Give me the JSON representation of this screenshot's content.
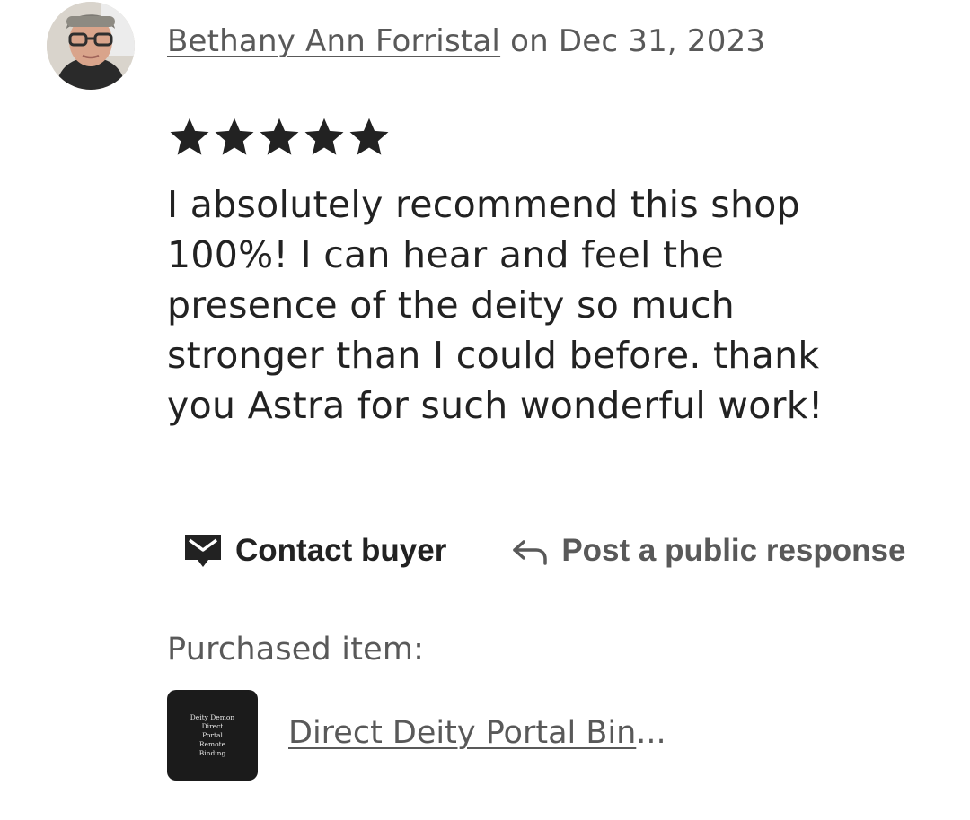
{
  "review": {
    "reviewer_name": "Bethany Ann Forristal",
    "date_text": " on Dec 31, 2023",
    "rating": 5,
    "rating_max": 5,
    "star_color": "#222222",
    "text": "I absolutely recommend this shop 100%! I can hear and feel the presence of the deity so much stronger than I could before. thank you Astra for such wonderful work!"
  },
  "actions": {
    "contact_label": "Contact buyer",
    "contact_icon": "mail-chat-icon",
    "response_label": "Post a public response",
    "response_icon": "reply-arrow-icon"
  },
  "purchase": {
    "label": "Purchased item:",
    "item_title": "Direct Deity Portal Bin",
    "item_ellipsis": "...",
    "thumb_lines": [
      "Deity Demon",
      "Direct",
      "Portal",
      "Remote",
      "Binding"
    ]
  },
  "colors": {
    "text_primary": "#222222",
    "text_secondary": "#595959",
    "thumb_bg": "#1b1b1b"
  }
}
